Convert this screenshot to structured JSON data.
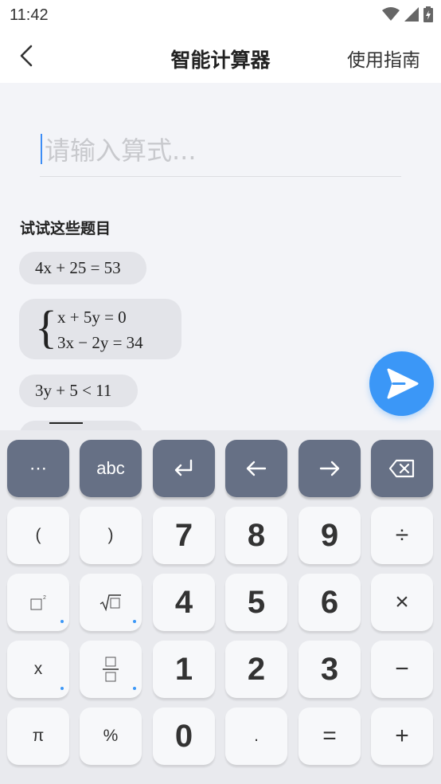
{
  "status_bar": {
    "time": "11:42"
  },
  "header": {
    "title": "智能计算器",
    "guide_label": "使用指南"
  },
  "input": {
    "placeholder": "请输入算式..."
  },
  "examples": {
    "heading": "试试这些题目",
    "items": [
      {
        "text": "4x + 25 = 53"
      },
      {
        "line1": "x + 5y = 0",
        "line2": "3x − 2y = 34"
      },
      {
        "text": "3y + 5 < 11"
      }
    ]
  },
  "keyboard": {
    "function_row": [
      {
        "label": "⋯",
        "icon": "more-icon"
      },
      {
        "label": "abc",
        "icon": ""
      },
      {
        "label": "",
        "icon": "enter-icon"
      },
      {
        "label": "",
        "icon": "arrow-left-icon"
      },
      {
        "label": "",
        "icon": "arrow-right-icon"
      },
      {
        "label": "",
        "icon": "backspace-icon"
      }
    ],
    "row1": [
      "(",
      ")",
      "7",
      "8",
      "9",
      "÷"
    ],
    "row2": [
      "",
      "",
      "4",
      "5",
      "6",
      "×"
    ],
    "row3": [
      "x",
      "",
      "1",
      "2",
      "3",
      "−"
    ],
    "row4": [
      "π",
      "%",
      "0",
      ".",
      "=",
      "+"
    ]
  },
  "colors": {
    "accent": "#3b97f7",
    "dark_key": "#667085",
    "light_key": "#f7f8fa",
    "keyboard_bg": "#e9eaee",
    "chip_bg": "#e3e4e9"
  }
}
